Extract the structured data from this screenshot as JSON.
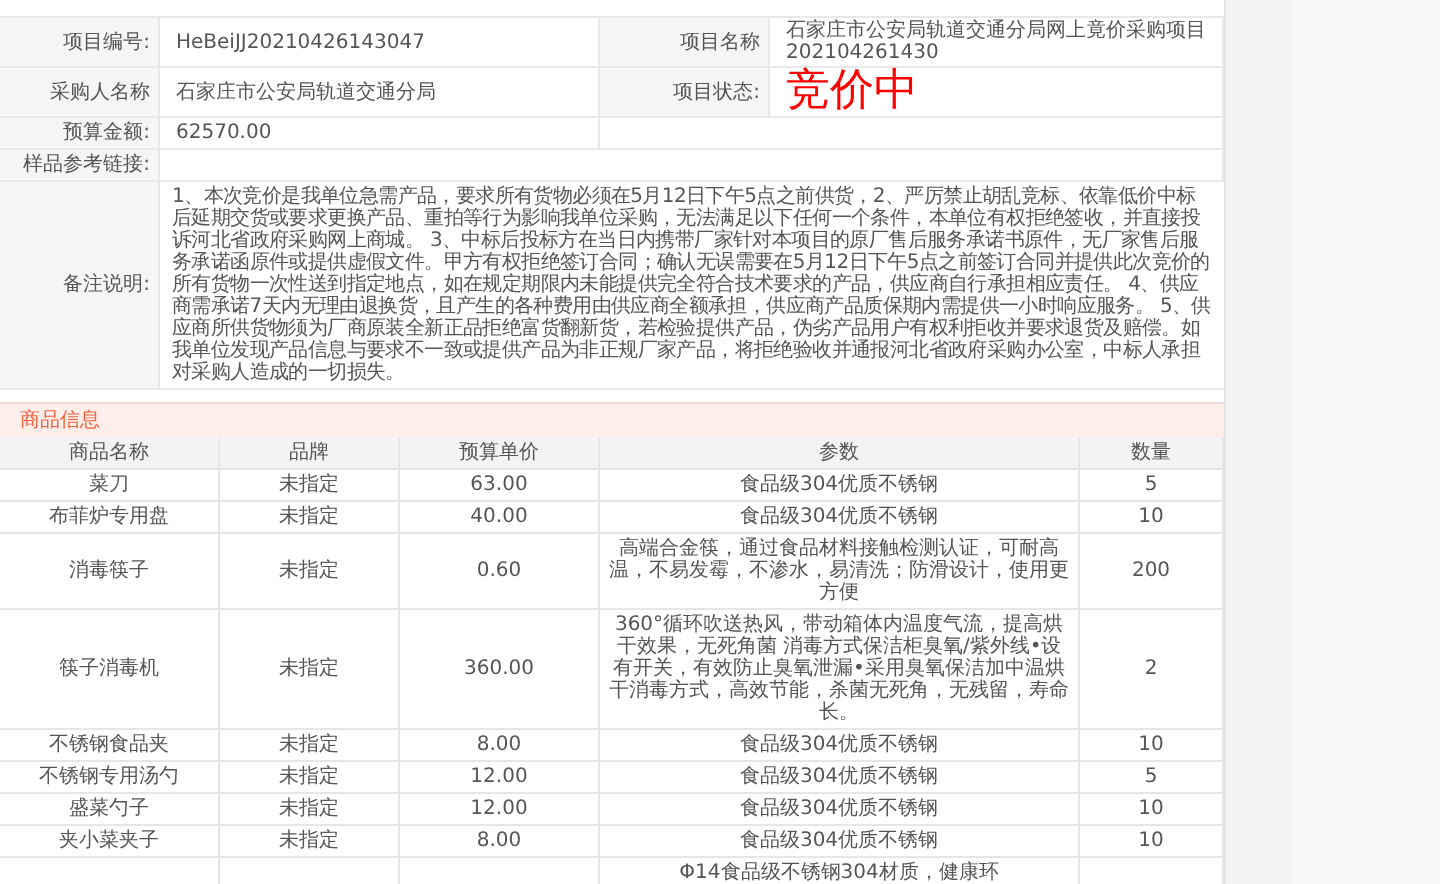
{
  "project_info": [
    {
      "label": "项目编号:",
      "value": "HeBeiJJ20210426143047",
      "label_2": "项目名称",
      "value_2": "石家庄市公安局轨道交通分局网上竟价采购项目202104261430"
    },
    {
      "label": "采购人名称",
      "value": "石家庄市公安局轨道交通分局",
      "label_2": "项目状态:",
      "status": "竞价中"
    },
    {
      "label": "预算金额:",
      "value": "62570.00"
    },
    {
      "label": "样品参考链接:"
    },
    {
      "label": "备注说明:",
      "value": "1、本次竞价是我单位急需产品，要求所有货物必须在5月12日下午5点之前供货，2、严厉禁止胡乱竞标、依靠低价中标后延期交货或要求更换产品、重拍等行为影响我单位采购，无法满足以下任何一个条件，本单位有权拒绝签收，并直接投诉河北省政府采购网上商城。 3、中标后投标方在当日内携带厂家针对本项目的原厂售后服务承诺书原件，无厂家售后服务承诺函原件或提供虚假文件。甲方有权拒绝签订合同；确认无误需要在5月12日下午5点之前签订合同并提供此次竞价的所有货物一次性送到指定地点，如在规定期限内未能提供完全符合技术要求的产品，供应商自行承担相应责任。 4、供应商需承诺7天内无理由退换货，且产生的各种费用由供应商全额承担，供应商产品质保期内需提供一小时响应服务。 5、供应商所供货物须为厂商原装全新正品拒绝富货翻新货，若检验提供产品，伪劣产品用户有权利拒收并要求退货及赔偿。如我单位发现产品信息与要求不一致或提供产品为非正规厂家产品，将拒绝验收并通报河北省政府采购办公室，中标人承担对采购人造成的一切损失。"
    }
  ],
  "goods": {
    "title": "商品信息",
    "columns": [
      "商品名称",
      "品牌",
      "预算单价",
      "参数",
      "数量"
    ],
    "rows": [
      [
        "菜刀",
        "未指定",
        "63.00",
        "食品级304优质不锈钢",
        "5"
      ],
      [
        "布菲炉专用盘",
        "未指定",
        "40.00",
        "食品级304优质不锈钢",
        "10"
      ],
      [
        "消毒筷子",
        "未指定",
        "0.60",
        "高端合金筷，通过食品材料接触检测认证，可耐高温，不易发霉，不渗水，易清洗；防滑设计，使用更方便",
        "200"
      ],
      [
        "筷子消毒机",
        "未指定",
        "360.00",
        "360°循环吹送热风，带动箱体内温度气流，提高烘干效果，无死角菌 消毒方式保洁柜臭氧/紫外线•设有开关，有效防止臭氧泄漏•采用臭氧保洁加中温烘干消毒方式，高效节能，杀菌无死角，无残留，寿命长。",
        "2"
      ],
      [
        "不锈钢食品夹",
        "未指定",
        "8.00",
        "食品级304优质不锈钢",
        "10"
      ],
      [
        "不锈钢专用汤勺",
        "未指定",
        "12.00",
        "食品级304优质不锈钢",
        "5"
      ],
      [
        "盛菜勺子",
        "未指定",
        "12.00",
        "食品级304优质不锈钢",
        "10"
      ],
      [
        "夹小菜夹子",
        "未指定",
        "8.00",
        "食品级304优质不锈钢",
        "10"
      ],
      [
        "",
        "",
        "",
        "Φ14食品级不锈钢304材质，健康环",
        ""
      ]
    ]
  }
}
